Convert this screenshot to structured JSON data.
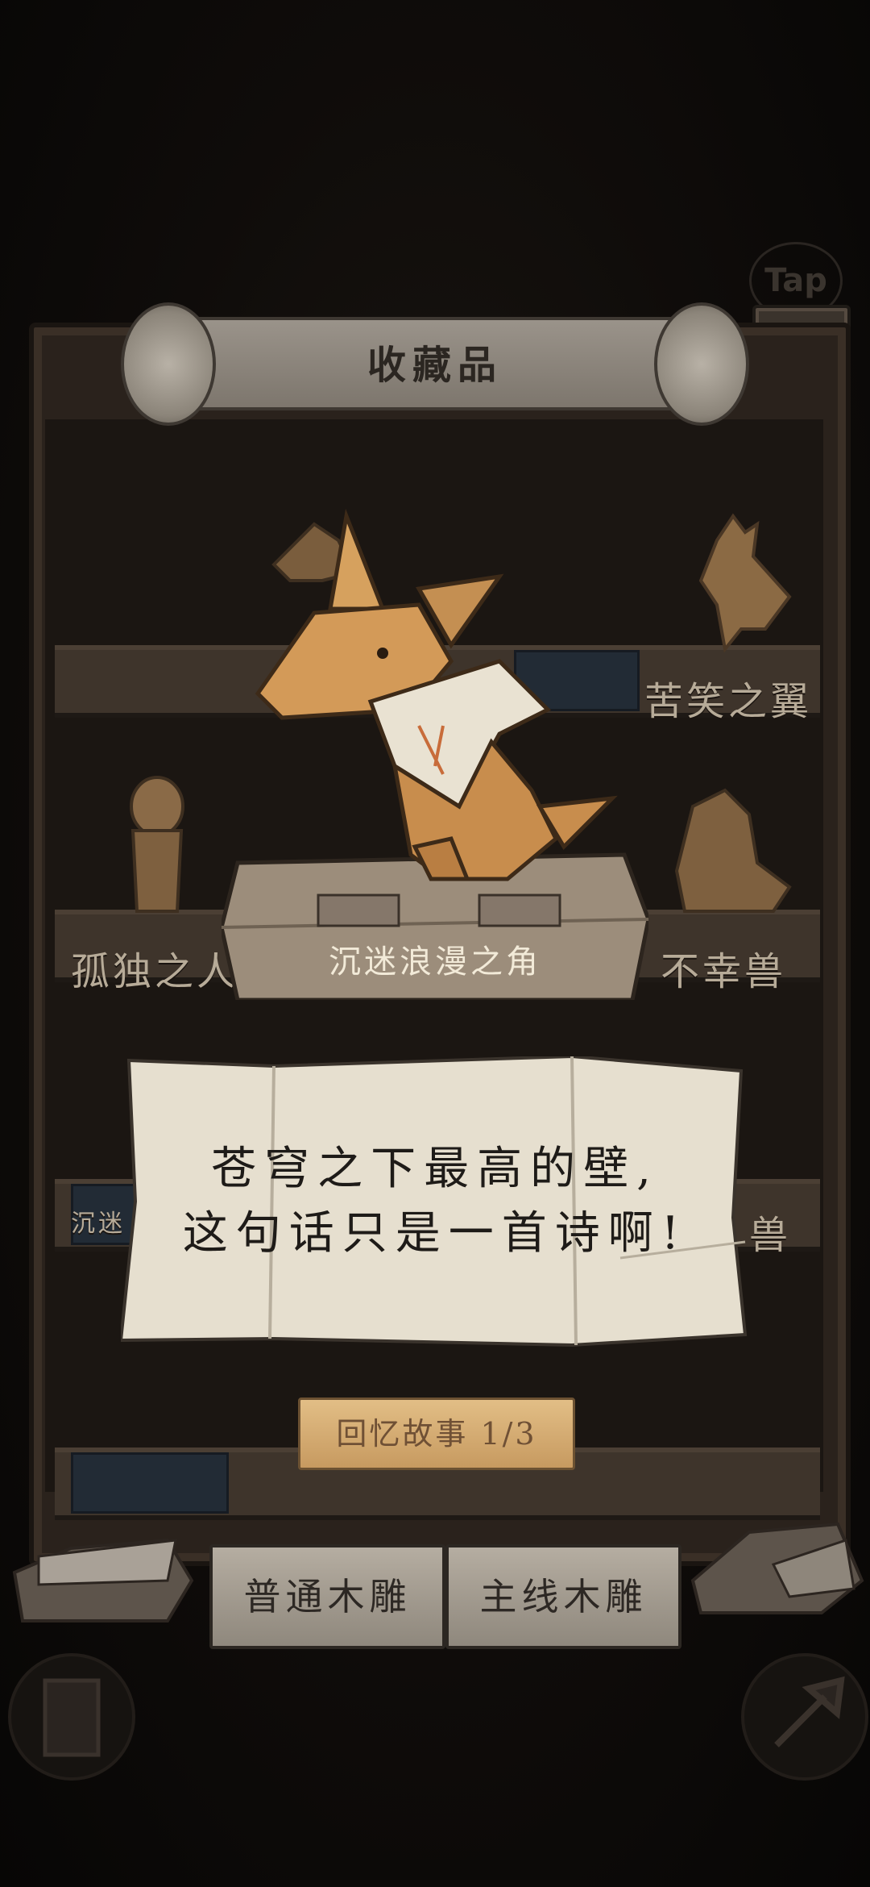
{
  "header": {
    "title": "收藏品",
    "tap_label": "Tap"
  },
  "shelves": {
    "row1_right": "苦笑之翼",
    "row2_left": "孤独之人",
    "row2_right": "不幸兽",
    "row3_left_partial": "沉迷",
    "row3_right_partial": "兽"
  },
  "featured": {
    "name": "沉迷浪漫之角"
  },
  "note": {
    "line1": "苍穹之下最高的壁,",
    "line2": "这句话只是一首诗啊!"
  },
  "memory_button": {
    "label": "回忆故事 1/3"
  },
  "tabs": {
    "normal": "普通木雕",
    "main": "主线木雕"
  },
  "colors": {
    "wood": "#c9955a",
    "paper": "#e8e1d1",
    "cabinet": "#2a221c"
  },
  "icons": {
    "close": "close-icon",
    "door": "door-icon",
    "axe": "axe-icon"
  }
}
